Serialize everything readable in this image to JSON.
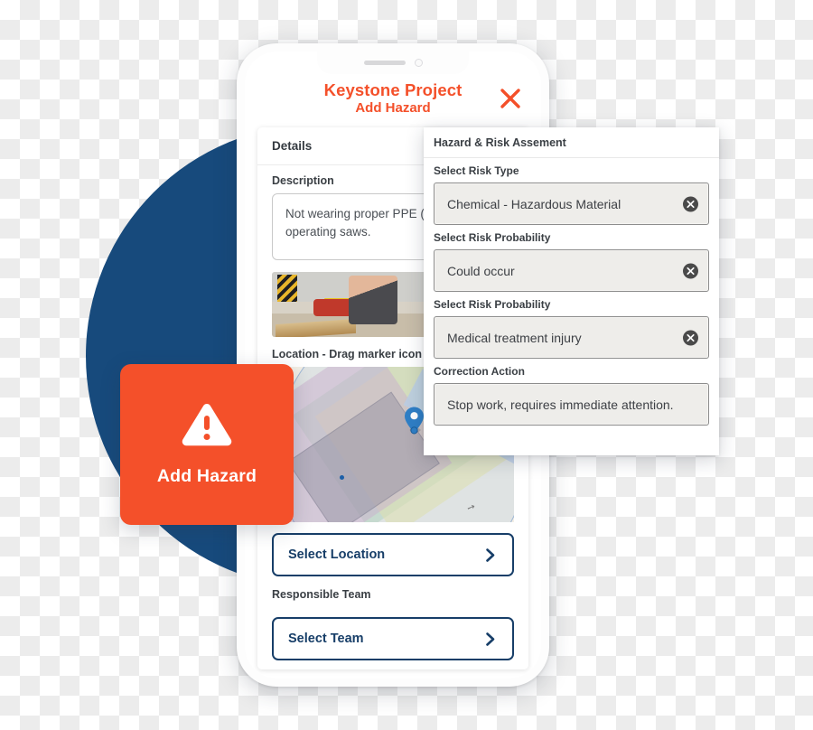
{
  "phone": {
    "header": {
      "project_title": "Keystone Project",
      "screen_subtitle": "Add Hazard",
      "close_icon": "close-icon"
    },
    "details_tab": "Details",
    "description": {
      "label": "Description",
      "value": "Not wearing proper PPE (so while operating saws."
    },
    "photos": [
      {
        "alt": "worker-using-circular-saw"
      },
      {
        "alt": "interior-jobsite-photo"
      }
    ],
    "location": {
      "label": "Location - Drag marker icon to",
      "marker_icon": "map-pin-icon"
    },
    "select_location_button": {
      "label": "Select Location",
      "chevron_icon": "chevron-right-icon"
    },
    "responsible_team": {
      "label": "Responsible Team",
      "select_team_button": {
        "label": "Select Team",
        "chevron_icon": "chevron-right-icon"
      }
    }
  },
  "add_hazard_card": {
    "label": "Add Hazard",
    "icon": "warning-triangle-icon"
  },
  "risk_panel": {
    "title": "Hazard & Risk Assement",
    "fields": [
      {
        "label": "Select Risk Type",
        "value": "Chemical - Hazardous Material",
        "clear_icon": "clear-circle-icon"
      },
      {
        "label": "Select Risk Probability",
        "value": "Could occur",
        "clear_icon": "clear-circle-icon"
      },
      {
        "label": "Select Risk Probability",
        "value": "Medical treatment injury",
        "clear_icon": "clear-circle-icon"
      },
      {
        "label": "Correction Action",
        "value": "Stop work, requires immediate attention.",
        "clear_icon": null
      }
    ]
  },
  "colors": {
    "accent_orange": "#F4502A",
    "navy": "#174A7C",
    "button_navy": "#173E68",
    "field_grey": "#eeedea"
  }
}
